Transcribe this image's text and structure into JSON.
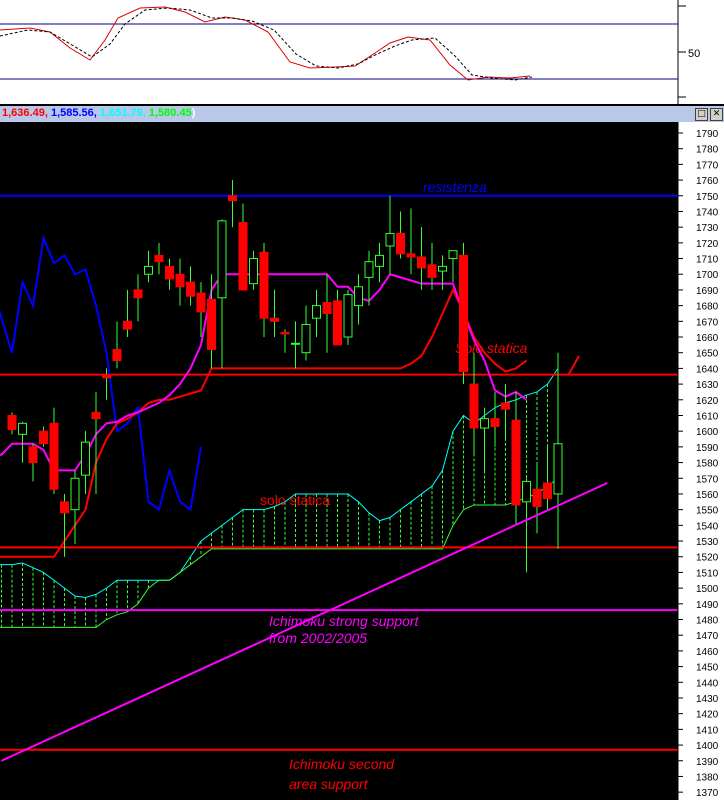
{
  "header": {
    "values": [
      "1,636.49",
      "1,585.56",
      "1,651.79",
      "1,580.45"
    ],
    "value_colors": [
      "#ff0000",
      "#0000ff",
      "#00ffff",
      "#00ff00"
    ],
    "close_paren": ")",
    "restore_icon": "□",
    "close_icon": "✕"
  },
  "oscillator": {
    "tick_label": "50",
    "levels": [
      80,
      20
    ],
    "ylim": [
      0,
      100
    ]
  },
  "chart_data": {
    "type": "candlestick",
    "ylim": [
      1365,
      1797
    ],
    "yticks": [
      1370,
      1380,
      1390,
      1400,
      1410,
      1420,
      1430,
      1440,
      1450,
      1460,
      1470,
      1480,
      1490,
      1500,
      1510,
      1520,
      1530,
      1540,
      1550,
      1560,
      1570,
      1580,
      1590,
      1600,
      1610,
      1620,
      1630,
      1640,
      1650,
      1660,
      1670,
      1680,
      1690,
      1700,
      1710,
      1720,
      1730,
      1740,
      1750,
      1760,
      1770,
      1780,
      1790
    ],
    "hlines": [
      {
        "y": 1750,
        "color": "#0000ff"
      },
      {
        "y": 1636,
        "color": "#ff0000"
      },
      {
        "y": 1526,
        "color": "#ff0000"
      },
      {
        "y": 1486,
        "color": "#ff00ff"
      },
      {
        "y": 1397,
        "color": "#ff0000"
      }
    ],
    "trendline": {
      "color": "#ff00ff",
      "from": [
        -1,
        1390
      ],
      "to": [
        56.7,
        1567
      ]
    },
    "candles": [
      [
        1610,
        1612,
        1598,
        1601
      ],
      [
        1598,
        1606,
        1580,
        1605
      ],
      [
        1590,
        1592,
        1568,
        1580
      ],
      [
        1600,
        1603,
        1590,
        1592
      ],
      [
        1605,
        1615,
        1560,
        1563
      ],
      [
        1555,
        1560,
        1520,
        1548
      ],
      [
        1550,
        1575,
        1528,
        1570
      ],
      [
        1572,
        1600,
        1560,
        1593
      ],
      [
        1612,
        1625,
        1560,
        1608
      ],
      [
        1636,
        1640,
        1620,
        1634
      ],
      [
        1652,
        1670,
        1640,
        1645
      ],
      [
        1670,
        1690,
        1660,
        1665
      ],
      [
        1690,
        1700,
        1670,
        1685
      ],
      [
        1700,
        1715,
        1695,
        1705
      ],
      [
        1712,
        1720,
        1700,
        1708
      ],
      [
        1705,
        1710,
        1690,
        1697
      ],
      [
        1700,
        1710,
        1680,
        1692
      ],
      [
        1695,
        1705,
        1680,
        1686
      ],
      [
        1688,
        1695,
        1660,
        1676
      ],
      [
        1684,
        1700,
        1640,
        1652
      ],
      [
        1685,
        1735,
        1640,
        1734
      ],
      [
        1750,
        1760,
        1730,
        1747
      ],
      [
        1733,
        1745,
        1690,
        1690
      ],
      [
        1694,
        1715,
        1690,
        1710
      ],
      [
        1714,
        1720,
        1660,
        1672
      ],
      [
        1672,
        1690,
        1660,
        1670
      ],
      [
        1663,
        1665,
        1650,
        1662
      ],
      [
        1656,
        1670,
        1640,
        1656
      ],
      [
        1650,
        1680,
        1645,
        1668
      ],
      [
        1672,
        1690,
        1660,
        1680
      ],
      [
        1682,
        1700,
        1650,
        1675
      ],
      [
        1683,
        1690,
        1660,
        1655
      ],
      [
        1660,
        1690,
        1655,
        1687
      ],
      [
        1680,
        1700,
        1668,
        1692
      ],
      [
        1698,
        1715,
        1680,
        1708
      ],
      [
        1705,
        1720,
        1695,
        1712
      ],
      [
        1718,
        1750,
        1700,
        1726
      ],
      [
        1726,
        1740,
        1710,
        1713
      ],
      [
        1713,
        1742,
        1700,
        1711
      ],
      [
        1711,
        1730,
        1690,
        1704
      ],
      [
        1706,
        1720,
        1690,
        1698
      ],
      [
        1702,
        1712,
        1690,
        1705
      ],
      [
        1710,
        1715,
        1695,
        1715
      ],
      [
        1712,
        1720,
        1630,
        1638
      ],
      [
        1630,
        1650,
        1585,
        1602
      ],
      [
        1602,
        1615,
        1575,
        1608
      ],
      [
        1608,
        1625,
        1590,
        1603
      ],
      [
        1618,
        1630,
        1595,
        1614
      ],
      [
        1607,
        1625,
        1540,
        1553
      ],
      [
        1555,
        1570,
        1510,
        1568
      ],
      [
        1563,
        1580,
        1535,
        1552
      ],
      [
        1567,
        1590,
        1550,
        1557
      ],
      [
        1560,
        1650,
        1525,
        1592
      ]
    ],
    "series": [
      {
        "color": "#0000ff",
        "x0": -2,
        "values": [
          1695,
          1672,
          1650,
          1695,
          1680,
          1723,
          1707,
          1712,
          1700,
          1703,
          1680,
          1650,
          1600,
          1605,
          1615,
          1555,
          1550,
          1575,
          1555,
          1550,
          1590
        ]
      },
      {
        "color": "#ff0000",
        "x0": -2,
        "values": [
          1520,
          1520,
          1520,
          1520,
          1520,
          1520,
          1520,
          1530,
          1540,
          1550,
          1580,
          1595,
          1605,
          1608,
          1612,
          1618,
          1620,
          1620,
          1622,
          1624,
          1626,
          1640,
          1640,
          1640,
          1640,
          1640,
          1640,
          1640,
          1640,
          1640,
          1640,
          1640,
          1640,
          1640,
          1640,
          1640,
          1640,
          1640,
          1640,
          1640,
          1643,
          1648,
          1660,
          1675,
          1690,
          1676,
          1660,
          1650,
          1643,
          1638,
          1640,
          1645
        ]
      },
      {
        "color": "#ff00ff",
        "x0": -2,
        "values": [
          1585,
          1585,
          1592,
          1592,
          1592,
          1588,
          1575,
          1575,
          1575,
          1585,
          1598,
          1605,
          1606,
          1610,
          1612,
          1615,
          1618,
          1623,
          1630,
          1640,
          1655,
          1690,
          1700,
          1700,
          1700,
          1700,
          1700,
          1700,
          1700,
          1700,
          1700,
          1700,
          1700,
          1692,
          1692,
          1685,
          1683,
          1690,
          1700,
          1698,
          1696,
          1694,
          1694,
          1694,
          1694,
          1675,
          1658,
          1645,
          1626,
          1622,
          1625,
          1620
        ]
      },
      {
        "color": "#ff0000",
        "x0": 53,
        "values": [
          1636,
          1648
        ]
      }
    ],
    "cloud": {
      "x0": -2,
      "line_color": "#00ffff",
      "fill_color": "#33ff33",
      "upper": [
        1515,
        1515,
        1515,
        1516,
        1513,
        1510,
        1505,
        1500,
        1495,
        1494,
        1496,
        1500,
        1505,
        1505,
        1505,
        1505,
        1505,
        1505,
        1510,
        1520,
        1530,
        1535,
        1540,
        1545,
        1550,
        1550,
        1550,
        1552,
        1555,
        1560,
        1560,
        1560,
        1560,
        1560,
        1560,
        1555,
        1548,
        1543,
        1545,
        1550,
        1555,
        1560,
        1565,
        1575,
        1600,
        1610,
        1605,
        1610,
        1615,
        1618,
        1620,
        1623,
        1625,
        1630,
        1640
      ],
      "lower": [
        1475,
        1475,
        1475,
        1475,
        1475,
        1475,
        1475,
        1475,
        1475,
        1475,
        1475,
        1480,
        1483,
        1485,
        1490,
        1500,
        1505,
        1505,
        1510,
        1515,
        1520,
        1525,
        1525,
        1525,
        1525,
        1525,
        1525,
        1525,
        1525,
        1525,
        1525,
        1525,
        1525,
        1525,
        1525,
        1525,
        1525,
        1525,
        1525,
        1525,
        1525,
        1525,
        1525,
        1525,
        1540,
        1550,
        1553,
        1553,
        1553,
        1553,
        1555,
        1558,
        1560,
        1565,
        1570
      ]
    },
    "annotations": [
      {
        "text": "resistenza",
        "color": "#0000ff"
      },
      {
        "text": "Solo statica",
        "color": "#ff0000"
      },
      {
        "text": "solo statica",
        "color": "#ff0000"
      },
      {
        "text": "Ichimoku strong support",
        "color": "#ff00ff"
      },
      {
        "text": "from 2002/2005",
        "color": "#ff00ff"
      },
      {
        "text": "Ichimoku second",
        "color": "#ff0000"
      },
      {
        "text": "area support",
        "color": "#ff0000"
      }
    ]
  }
}
